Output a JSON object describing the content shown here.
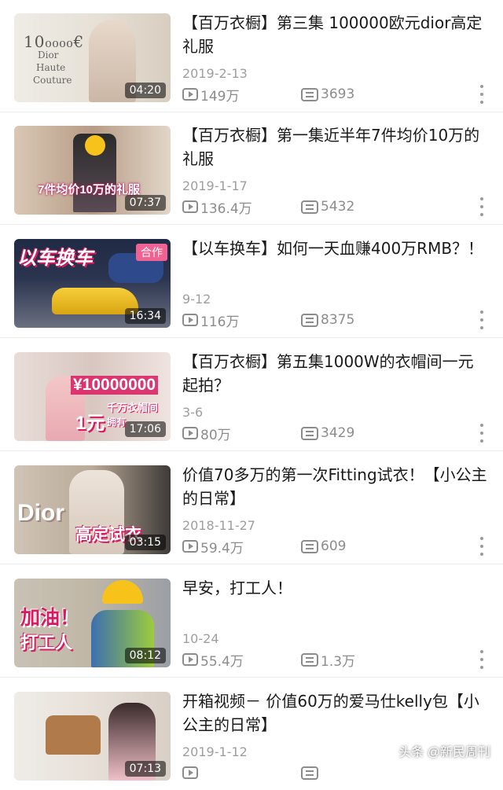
{
  "videos": [
    {
      "title": "【百万衣橱】第三集  100000欧元dior高定礼服",
      "date": "2019-2-13",
      "plays": "149万",
      "comments": "3693",
      "duration": "04:20",
      "thumb_text": [
        "10₀₀₀₀€",
        "Dior",
        "Haute",
        "Couture"
      ]
    },
    {
      "title": "【百万衣橱】第一集近半年7件均价10万的礼服",
      "date": "2019-1-17",
      "plays": "136.4万",
      "comments": "5432",
      "duration": "07:37",
      "thumb_text": [
        "7件均价10万的礼服"
      ]
    },
    {
      "title": "【以车换车】如何一天血赚400万RMB？！",
      "date": "9-12",
      "plays": "116万",
      "comments": "8375",
      "duration": "16:34",
      "thumb_text": [
        "以车换车",
        "合作"
      ]
    },
    {
      "title": "【百万衣橱】第五集1000W的衣帽间一元起拍？",
      "date": "3-6",
      "plays": "80万",
      "comments": "3429",
      "duration": "17:06",
      "thumb_text": [
        "¥10000000",
        "1元",
        "千万衣帽间",
        "拥有"
      ]
    },
    {
      "title": "价值70多万的第一次Fitting试衣！【小公主的日常】",
      "date": "2018-11-27",
      "plays": "59.4万",
      "comments": "609",
      "duration": "03:15",
      "thumb_text": [
        "Dior",
        "高定试衣"
      ]
    },
    {
      "title": "早安，打工人！",
      "date": "10-24",
      "plays": "55.4万",
      "comments": "1.3万",
      "duration": "08:12",
      "thumb_text": [
        "加油！",
        "打工人"
      ]
    },
    {
      "title": "开箱视频－ 价值60万的爱马仕kelly包【小公主的日常】",
      "date": "2019-1-12",
      "plays": "",
      "comments": "",
      "duration": "07:13",
      "thumb_text": []
    }
  ],
  "watermark": "头条 @新民周刊",
  "colors": {
    "text": "#1a1a1a",
    "meta": "#8c8c8c",
    "date": "#9e9e9e",
    "divider": "#ececec"
  }
}
